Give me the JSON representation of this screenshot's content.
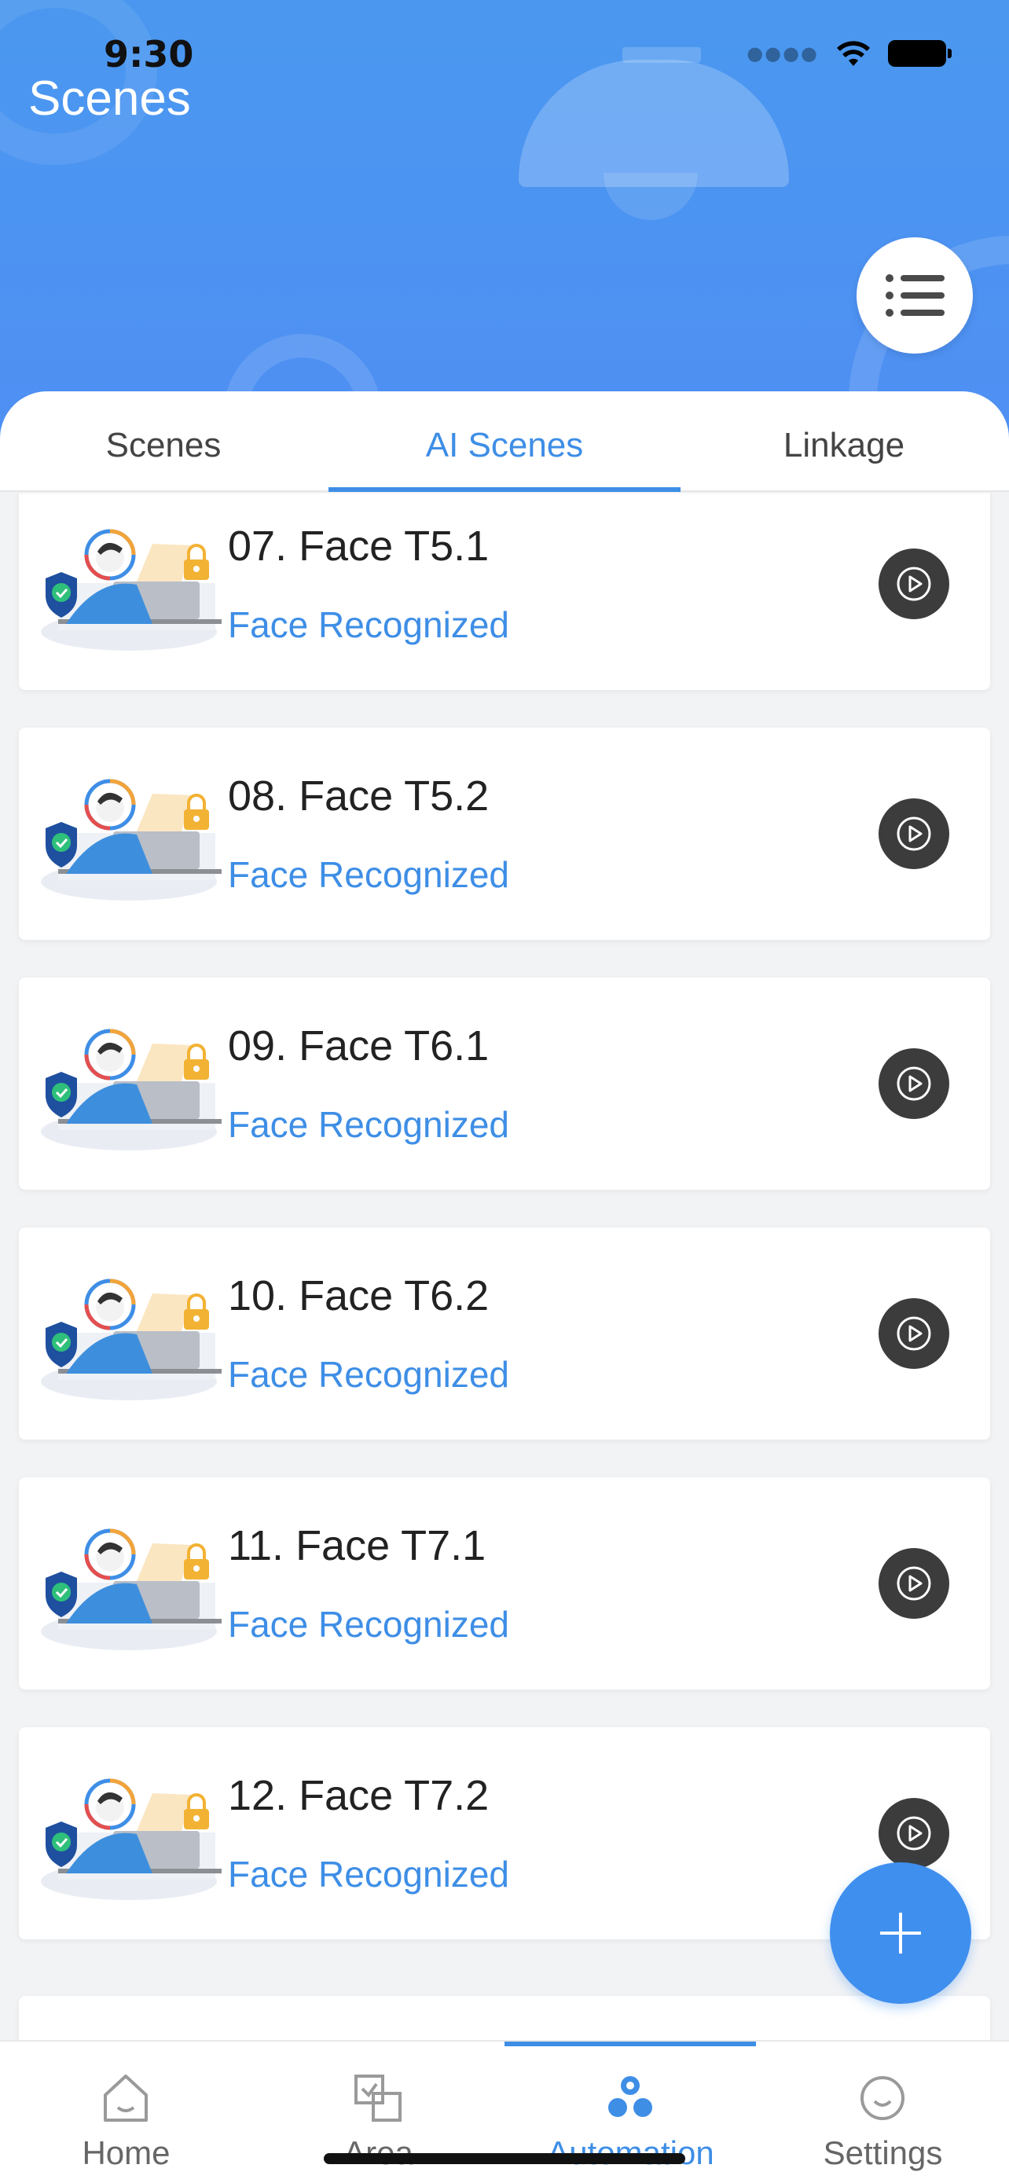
{
  "status_bar": {
    "time": "9:30"
  },
  "header": {
    "title": "Scenes"
  },
  "tabs": [
    {
      "label": "Scenes",
      "active": false
    },
    {
      "label": "AI Scenes",
      "active": true
    },
    {
      "label": "Linkage",
      "active": false
    }
  ],
  "scenes": [
    {
      "title": "07. Face T5.1",
      "subtitle": "Face Recognized"
    },
    {
      "title": "08. Face T5.2",
      "subtitle": "Face Recognized"
    },
    {
      "title": "09. Face T6.1",
      "subtitle": "Face Recognized"
    },
    {
      "title": "10. Face T6.2",
      "subtitle": "Face Recognized"
    },
    {
      "title": "11. Face T7.1",
      "subtitle": "Face Recognized"
    },
    {
      "title": "12. Face T7.2",
      "subtitle": "Face Recognized"
    }
  ],
  "bottom_nav": [
    {
      "label": "Home",
      "icon": "home-icon",
      "active": false
    },
    {
      "label": "Area",
      "icon": "area-icon",
      "active": false
    },
    {
      "label": "Automation",
      "icon": "automation-icon",
      "active": true
    },
    {
      "label": "Settings",
      "icon": "settings-icon",
      "active": false
    }
  ],
  "colors": {
    "accent": "#3e8ee6",
    "header": "#4a98f0",
    "play": "#3c3c3c"
  }
}
